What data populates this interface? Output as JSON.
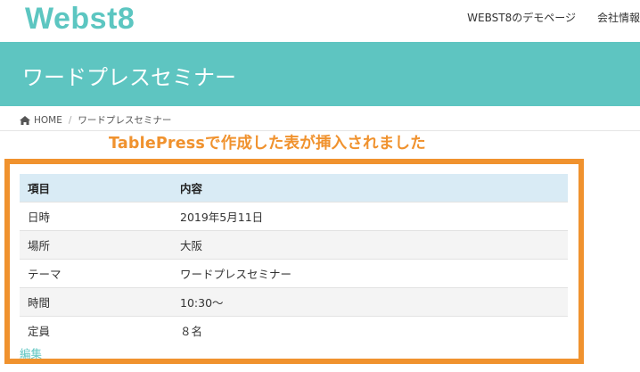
{
  "header": {
    "logo": "Webst8",
    "nav": [
      "WEBST8のデモページ",
      "会社情報"
    ]
  },
  "title_bar": {
    "title": "ワードプレスセミナー"
  },
  "breadcrumb": {
    "home": "HOME",
    "current": "ワードプレスセミナー"
  },
  "annotation": {
    "text": "TablePressで作成した表が挿入されました",
    "color": "#f0922e"
  },
  "table": {
    "headers": [
      "項目",
      "内容"
    ],
    "rows": [
      [
        "日時",
        "2019年5月11日"
      ],
      [
        "場所",
        "大阪"
      ],
      [
        "テーマ",
        "ワードプレスセミナー"
      ],
      [
        "時間",
        "10:30〜"
      ],
      [
        "定員",
        "８名"
      ]
    ]
  },
  "edit_link": "編集",
  "colors": {
    "accent": "#5ec5c1",
    "table_header_bg": "#d9ebf5",
    "highlight": "#f0922e"
  }
}
